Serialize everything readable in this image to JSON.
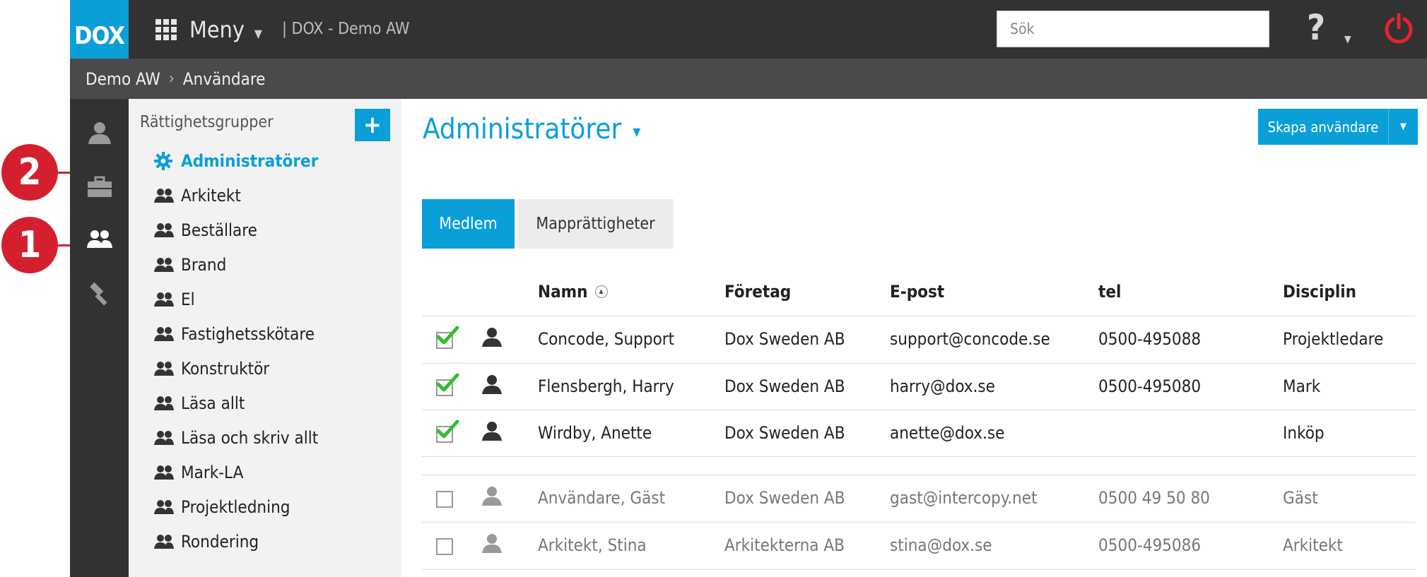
{
  "markers": {
    "one": "1",
    "two": "2"
  },
  "topbar": {
    "logo": "DOX",
    "menu_label": "Meny",
    "project": "| DOX - Demo AW",
    "search_placeholder": "Sök",
    "help_glyph": "?",
    "accent_color": "#0b9fd8",
    "power_color": "#e0262d"
  },
  "breadcrumb": {
    "root": "Demo AW",
    "current": "Användare"
  },
  "rail": {
    "items": [
      "person-icon",
      "briefcase-icon",
      "group-icon",
      "hammer-icon"
    ]
  },
  "groups": {
    "title": "Rättighetsgrupper",
    "add_label": "+",
    "items": [
      {
        "label": "Administratörer",
        "active": true
      },
      {
        "label": "Arkitekt"
      },
      {
        "label": "Beställare"
      },
      {
        "label": "Brand"
      },
      {
        "label": "El"
      },
      {
        "label": "Fastighetsskötare"
      },
      {
        "label": "Konstruktör"
      },
      {
        "label": "Läsa allt"
      },
      {
        "label": "Läsa och skriv allt"
      },
      {
        "label": "Mark-LA"
      },
      {
        "label": "Projektledning"
      },
      {
        "label": "Rondering"
      }
    ]
  },
  "main": {
    "title": "Administratörer",
    "create_label": "Skapa användare",
    "tabs": [
      {
        "label": "Medlem",
        "active": true
      },
      {
        "label": "Mapprättigheter"
      }
    ],
    "columns": [
      "Namn",
      "Företag",
      "E-post",
      "tel",
      "Disciplin"
    ],
    "members": [
      {
        "name": "Concode, Support",
        "company": "Dox Sweden AB",
        "email": "support@concode.se",
        "tel": "0500-495088",
        "discipline": "Projektledare",
        "checked": true
      },
      {
        "name": "Flensbergh, Harry",
        "company": "Dox Sweden AB",
        "email": "harry@dox.se",
        "tel": "0500-495080",
        "discipline": "Mark",
        "checked": true
      },
      {
        "name": "Wirdby, Anette",
        "company": "Dox Sweden AB",
        "email": "anette@dox.se",
        "tel": "",
        "discipline": "Inköp",
        "checked": true
      }
    ],
    "others": [
      {
        "name": "Användare, Gäst",
        "company": "Dox Sweden AB",
        "email": "gast@intercopy.net",
        "tel": "0500 49 50 80",
        "discipline": "Gäst",
        "checked": false
      },
      {
        "name": "Arkitekt, Stina",
        "company": "Arkitekterna AB",
        "email": "stina@dox.se",
        "tel": "0500-495086",
        "discipline": "Arkitekt",
        "checked": false
      }
    ]
  }
}
